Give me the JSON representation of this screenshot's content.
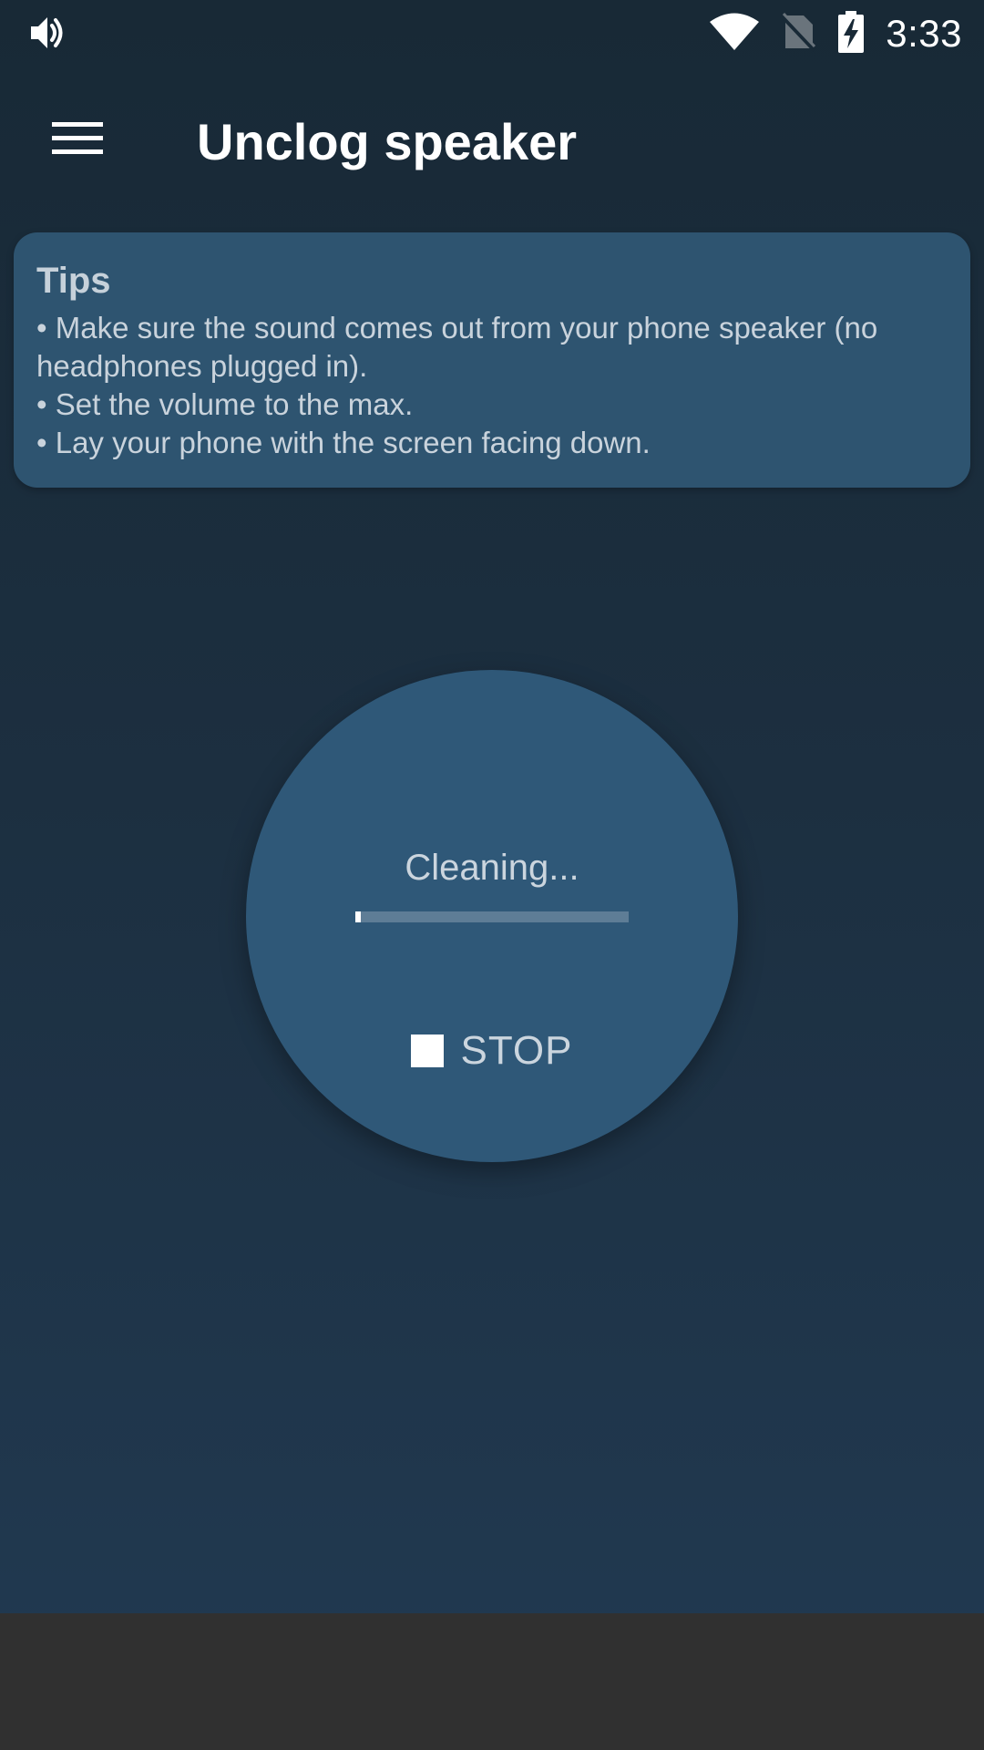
{
  "status_bar": {
    "time": "3:33",
    "icons": [
      "volume-icon",
      "wifi-icon",
      "no-sim-icon",
      "battery-charging-icon"
    ]
  },
  "app_bar": {
    "title": "Unclog speaker",
    "menu_icon": "hamburger-menu-icon"
  },
  "tips": {
    "title": "Tips",
    "lines": [
      "• Make sure the sound comes out from your phone speaker (no headphones plugged in).",
      "• Set the volume to the max.",
      "• Lay your phone with the screen facing down."
    ]
  },
  "cleaner": {
    "status_text": "Cleaning...",
    "progress_fraction": 0.02,
    "stop_label": "STOP",
    "stop_icon": "stop-square-icon"
  },
  "colors": {
    "background_top": "#182936",
    "background_bottom": "#213a52",
    "card": "#2e5470",
    "circle": "#2f5878",
    "progress_track": "#5e7d96",
    "nav_bar": "#303030"
  }
}
